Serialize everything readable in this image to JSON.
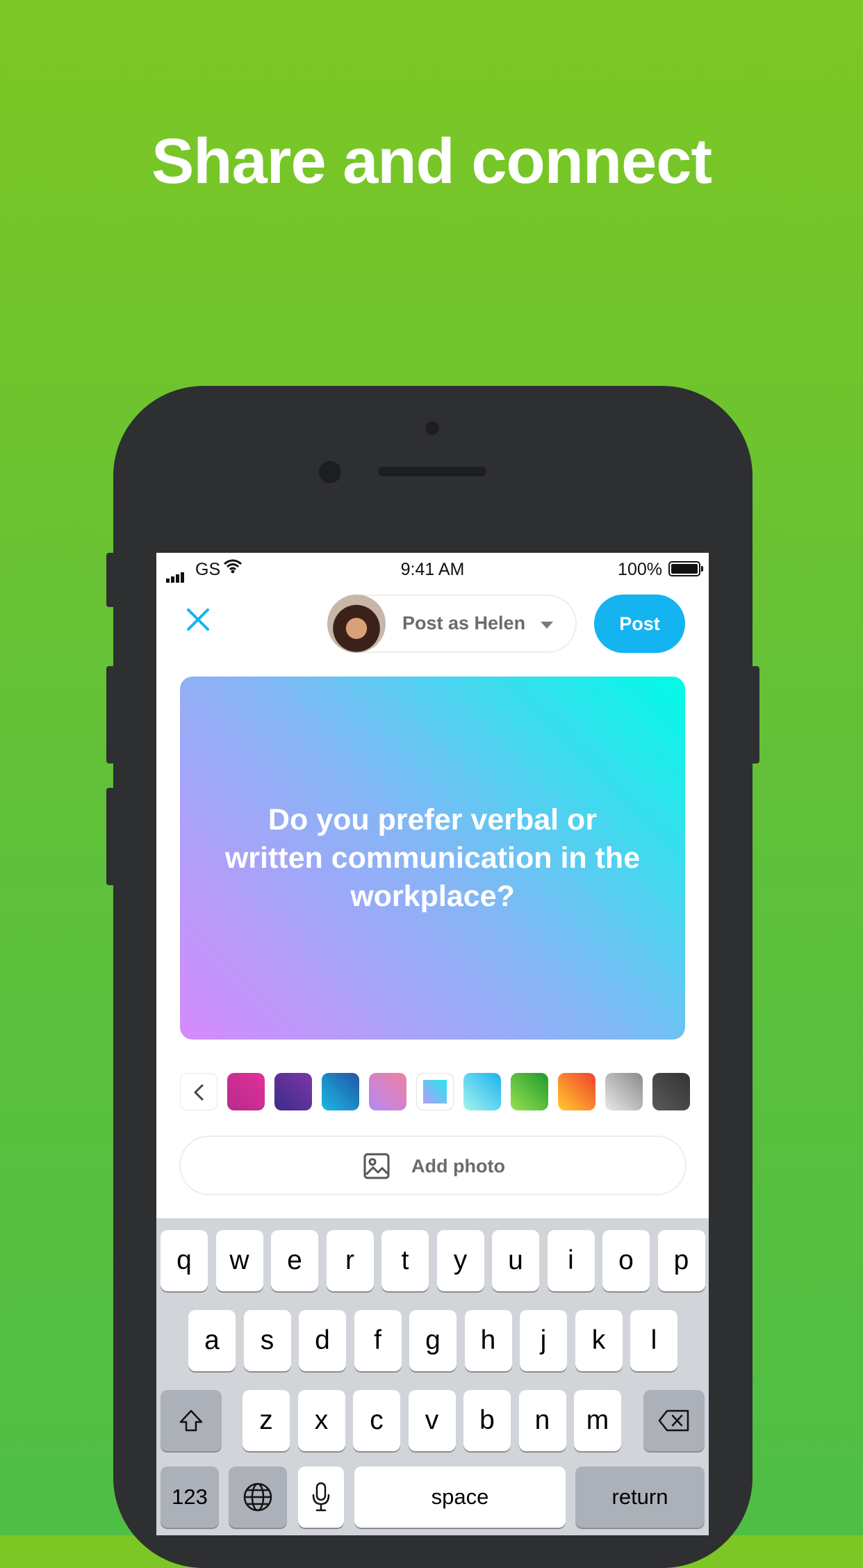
{
  "headline": "Share and connect",
  "status_bar": {
    "carrier": "GS",
    "time": "9:41 AM",
    "battery_percent": "100%"
  },
  "composer": {
    "post_as_label": "Post as Helen",
    "post_button_label": "Post",
    "question": "Do you prefer verbal or written communication in the workplace?",
    "add_photo_label": "Add photo",
    "selected_swatch_index": 4,
    "swatches": [
      {
        "name": "magenta",
        "gradient": [
          "#b72b8a",
          "#e0309a"
        ]
      },
      {
        "name": "purple",
        "gradient": [
          "#3e2a8a",
          "#7b38a8"
        ]
      },
      {
        "name": "ocean",
        "gradient": [
          "#1bb9e4",
          "#2155a6"
        ]
      },
      {
        "name": "lilac-pink",
        "gradient": [
          "#b48af3",
          "#f07ea0"
        ]
      },
      {
        "name": "lilac-cyan",
        "gradient": [
          "#d68afb",
          "#00fbe7"
        ]
      },
      {
        "name": "aqua",
        "gradient": [
          "#a7f3ec",
          "#19b4f2"
        ]
      },
      {
        "name": "green",
        "gradient": [
          "#98e052",
          "#1f9a2a"
        ]
      },
      {
        "name": "orange",
        "gradient": [
          "#ffcc2f",
          "#f2402e"
        ]
      },
      {
        "name": "silver",
        "gradient": [
          "#e8e8e8",
          "#8a8a8a"
        ]
      },
      {
        "name": "charcoal",
        "gradient": [
          "#5a5a5a",
          "#333333"
        ]
      }
    ]
  },
  "keyboard": {
    "row1": [
      "q",
      "w",
      "e",
      "r",
      "t",
      "y",
      "u",
      "i",
      "o",
      "p"
    ],
    "row2": [
      "a",
      "s",
      "d",
      "f",
      "g",
      "h",
      "j",
      "k",
      "l"
    ],
    "row3": [
      "z",
      "x",
      "c",
      "v",
      "b",
      "n",
      "m"
    ],
    "numbers_label": "123",
    "space_label": "space",
    "return_label": "return"
  },
  "colors": {
    "background_top": "#7dc724",
    "background_bottom": "#4fbe45",
    "accent": "#14b4f0",
    "device": "#2e2f31"
  }
}
